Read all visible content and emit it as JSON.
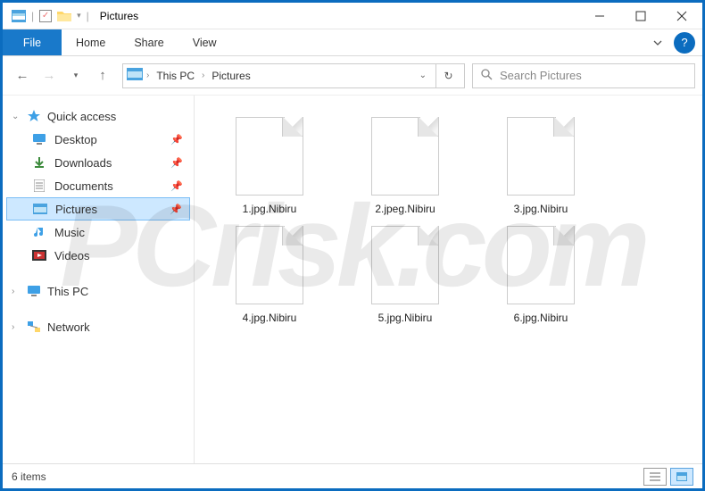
{
  "window": {
    "title": "Pictures"
  },
  "ribbon": {
    "file": "File",
    "tabs": [
      "Home",
      "Share",
      "View"
    ]
  },
  "nav": {
    "crumbs": [
      "This PC",
      "Pictures"
    ]
  },
  "search": {
    "placeholder": "Search Pictures"
  },
  "sidebar": {
    "quick_access": "Quick access",
    "items": [
      {
        "icon": "desktop",
        "label": "Desktop",
        "pinned": true
      },
      {
        "icon": "downloads",
        "label": "Downloads",
        "pinned": true
      },
      {
        "icon": "documents",
        "label": "Documents",
        "pinned": true
      },
      {
        "icon": "pictures",
        "label": "Pictures",
        "pinned": true,
        "selected": true
      },
      {
        "icon": "music",
        "label": "Music",
        "pinned": false
      },
      {
        "icon": "videos",
        "label": "Videos",
        "pinned": false
      }
    ],
    "this_pc": "This PC",
    "network": "Network"
  },
  "files": [
    {
      "name": "1.jpg.Nibiru"
    },
    {
      "name": "2.jpeg.Nibiru"
    },
    {
      "name": "3.jpg.Nibiru"
    },
    {
      "name": "4.jpg.Nibiru"
    },
    {
      "name": "5.jpg.Nibiru"
    },
    {
      "name": "6.jpg.Nibiru"
    }
  ],
  "status": {
    "count_label": "6 items"
  },
  "watermark": "PCrisk.com"
}
